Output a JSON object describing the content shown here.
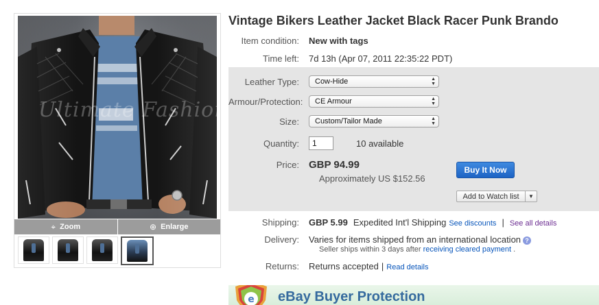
{
  "gallery": {
    "watermark": "Ultimate Fashions",
    "zoom_label": "Zoom",
    "enlarge_label": "Enlarge",
    "zoom_icon": "crosshair-icon",
    "enlarge_icon": "magnifier-plus-icon"
  },
  "listing": {
    "title": "Vintage Bikers Leather Jacket Black Racer Punk Brando",
    "condition_label": "Item condition:",
    "condition_value": "New with tags",
    "time_left_label": "Time left:",
    "time_left_value": "7d 13h (Apr 07, 2011 22:35:22 PDT)"
  },
  "options": {
    "leather_label": "Leather Type:",
    "leather_value": "Cow-Hide",
    "armour_label": "Armour/Protection:",
    "armour_value": "CE Armour",
    "size_label": "Size:",
    "size_value": "Custom/Tailor Made",
    "quantity_label": "Quantity:",
    "quantity_value": "1",
    "available": "10 available"
  },
  "price": {
    "label": "Price:",
    "value": "GBP 94.99",
    "approx": "Approximately US $152.56",
    "buy_button": "Buy It Now",
    "watch_button": "Add to Watch list"
  },
  "shipping": {
    "label": "Shipping:",
    "cost": "GBP 5.99",
    "method": "Expedited Int'l Shipping",
    "see_discounts": "See discounts",
    "separator": "|",
    "see_all": "See all details"
  },
  "delivery": {
    "label": "Delivery:",
    "text": "Varies for items shipped from an international location",
    "sub_prefix": "Seller ships within 3 days after",
    "sub_link": "receiving cleared payment",
    "sub_suffix": "."
  },
  "returns": {
    "label": "Returns:",
    "value": "Returns accepted",
    "separator": "|",
    "link": "Read details"
  },
  "banner": {
    "text": "eBay Buyer Protection"
  },
  "colors": {
    "buy_button": "#1d63c4",
    "link": "#0654ba",
    "options_panel": "#e5e5e5",
    "banner_text": "#356a9e"
  }
}
